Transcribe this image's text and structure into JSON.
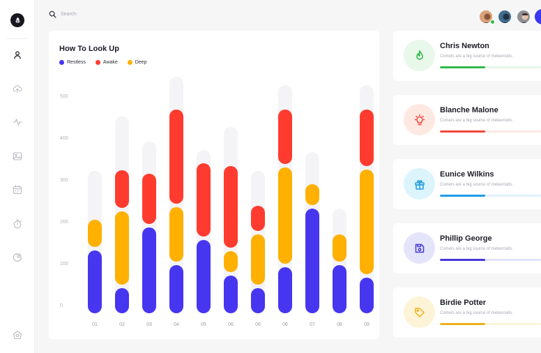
{
  "search": {
    "placeholder": "Search"
  },
  "nav": {
    "items": [
      {
        "icon": "user-icon"
      },
      {
        "icon": "cloud-upload-icon"
      },
      {
        "icon": "activity-icon"
      },
      {
        "icon": "image-icon"
      },
      {
        "icon": "calendar-icon"
      },
      {
        "icon": "timer-icon"
      },
      {
        "icon": "pie-chart-icon"
      },
      {
        "icon": "settings-icon"
      }
    ]
  },
  "chart": {
    "title": "How To Look Up",
    "legend": [
      {
        "label": "Restless",
        "color": "#4636f0"
      },
      {
        "label": "Awake",
        "color": "#ff3b2f"
      },
      {
        "label": "Deep",
        "color": "#ffb000"
      }
    ]
  },
  "chart_data": {
    "type": "bar",
    "stacked": true,
    "title": "How To Look Up",
    "yticks": [
      "0",
      "100",
      "200",
      "300",
      "400",
      "500"
    ],
    "ylim": [
      0,
      540
    ],
    "categories": [
      "01",
      "02",
      "03",
      "04",
      "05",
      "06",
      "06",
      "06",
      "07",
      "08",
      "09"
    ],
    "background_totals": [
      340,
      470,
      410,
      565,
      390,
      445,
      340,
      545,
      385,
      250,
      545
    ],
    "series": [
      {
        "name": "Restless",
        "color": "#4636f0",
        "values": [
          150,
          60,
          205,
          115,
          175,
          90,
          60,
          110,
          250,
          115,
          85
        ]
      },
      {
        "name": "Deep",
        "color": "#ffb000",
        "values": [
          65,
          175,
          0,
          130,
          0,
          50,
          120,
          230,
          50,
          65,
          250
        ]
      },
      {
        "name": "Awake",
        "color": "#ff3b2f",
        "values": [
          0,
          90,
          120,
          225,
          175,
          195,
          60,
          130,
          0,
          0,
          135
        ]
      }
    ],
    "grid": false
  },
  "people": [
    {
      "name": "Chris Newton",
      "desc": "Comets are a big source of meteoroids.",
      "progress": 0.45,
      "color": "#31b94a",
      "track": "#e6f6e8",
      "bg": "#e8f8ea",
      "icon": "flame-icon"
    },
    {
      "name": "Blanche Malone",
      "desc": "Comets are a big source of meteoroids.",
      "progress": 0.45,
      "color": "#f2483a",
      "track": "#fde8e2",
      "bg": "#fde9e2",
      "icon": "lightbulb-icon"
    },
    {
      "name": "Eunice Wilkins",
      "desc": "Comets are a big source of meteoroids.",
      "progress": 0.45,
      "color": "#1e9ce6",
      "track": "#e1f3fd",
      "bg": "#dcf4fc",
      "icon": "gift-icon"
    },
    {
      "name": "Phillip George",
      "desc": "Comets are a big source of meteoroids.",
      "progress": 0.45,
      "color": "#4338d9",
      "track": "#e3e3f9",
      "bg": "#e4e4fa",
      "icon": "save-icon"
    },
    {
      "name": "Birdie Potter",
      "desc": "Comets are a big source of meteoroids.",
      "progress": 0.45,
      "color": "#f0b01c",
      "track": "#fdf4dc",
      "bg": "#fdf3d6",
      "icon": "tag-icon"
    }
  ]
}
